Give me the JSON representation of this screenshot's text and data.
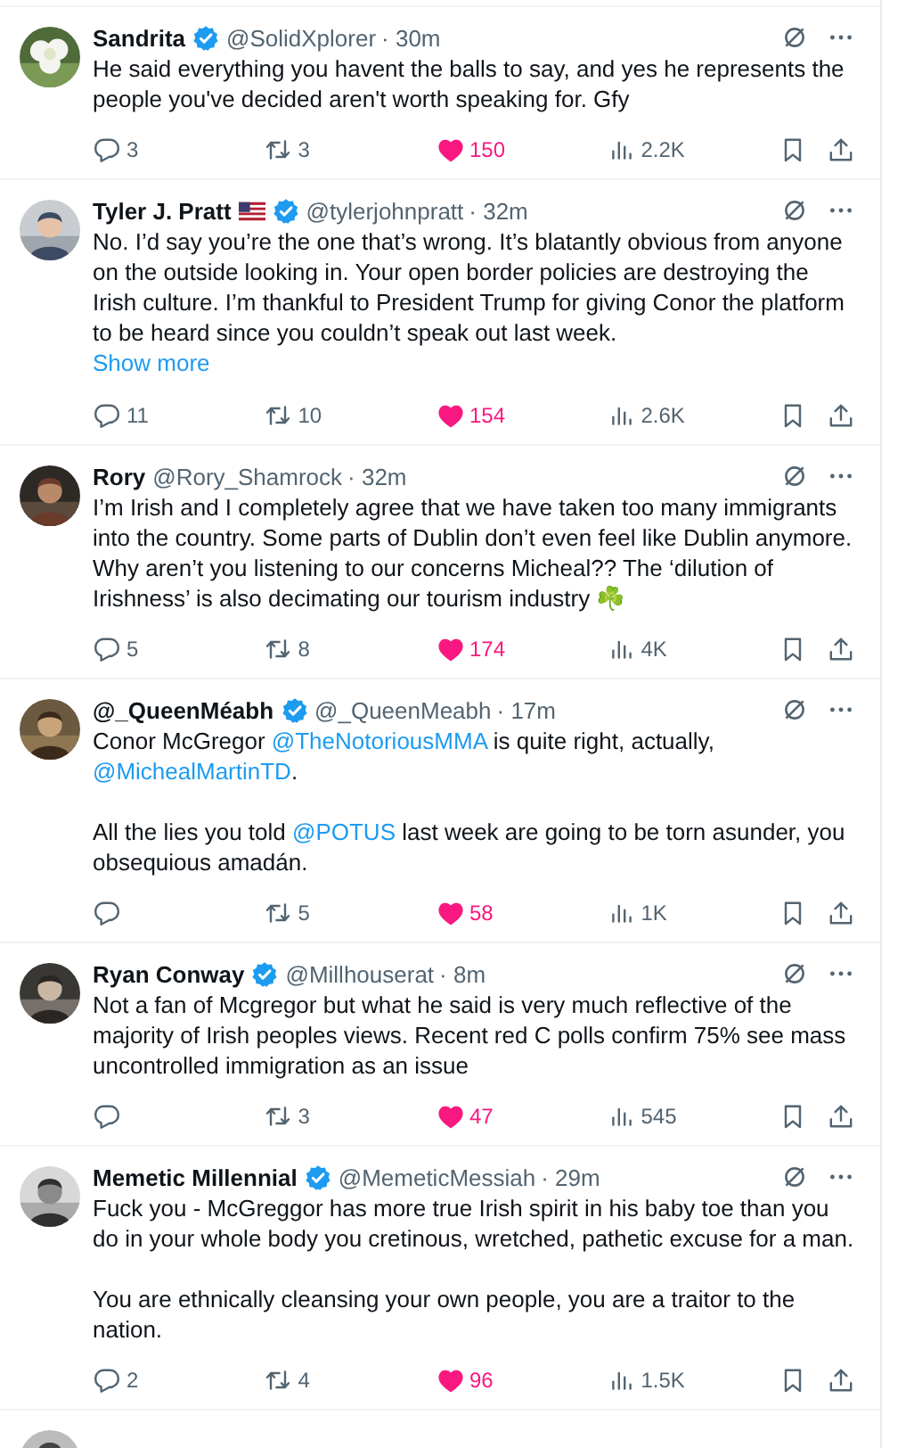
{
  "tweets": [
    {
      "kind": "post",
      "name": "Sandrita",
      "flag": false,
      "verified": true,
      "handle": "@SolidXplorer",
      "time": "· 30m",
      "paragraphs": [
        [
          {
            "text": "He said everything you havent the balls to say, and yes he represents the people you've decided aren't worth speaking for. Gfy",
            "kind": "text"
          }
        ]
      ],
      "replies": "3",
      "reposts": "3",
      "likes": "150",
      "views": "2.2K",
      "liked": true
    },
    {
      "kind": "post",
      "name": "Tyler J. Pratt",
      "flag": true,
      "verified": true,
      "handle": "@tylerjohnpratt",
      "time": "· 32m",
      "paragraphs": [
        [
          {
            "text": "No. I’d say you’re the one that’s wrong. It’s blatantly obvious from anyone on the outside looking in. Your open border policies are destroying the Irish culture. I’m thankful to President Trump for giving Conor the platform to be heard since you couldn’t speak out last week.",
            "kind": "text"
          }
        ]
      ],
      "show_more": "Show more",
      "replies": "11",
      "reposts": "10",
      "likes": "154",
      "views": "2.6K",
      "liked": true
    },
    {
      "kind": "post",
      "name": "Rory",
      "flag": false,
      "verified": false,
      "handle": "@Rory_Shamrock",
      "time": "· 32m",
      "paragraphs": [
        [
          {
            "text": "I’m Irish and I completely agree that we have taken too many immigrants into the country. Some parts of Dublin don’t even feel like Dublin anymore. Why aren’t you listening to our concerns Micheal?? The ‘dilution of Irishness’ is also decimating our tourism industry ☘️",
            "kind": "text"
          }
        ]
      ],
      "replies": "5",
      "reposts": "8",
      "likes": "174",
      "views": "4K",
      "liked": true
    },
    {
      "kind": "post",
      "name": "@_QueenMéabh",
      "flag": false,
      "verified": true,
      "handle": "@_QueenMeabh",
      "time": "· 17m",
      "paragraphs": [
        [
          {
            "text": "Conor McGregor ",
            "kind": "text"
          },
          {
            "text": "@TheNotoriousMMA",
            "kind": "mention"
          },
          {
            "text": " is quite right, actually, ",
            "kind": "text"
          },
          {
            "text": "@MichealMartinTD",
            "kind": "mention"
          },
          {
            "text": ".",
            "kind": "text"
          }
        ],
        [
          {
            "text": "All the lies you told ",
            "kind": "text"
          },
          {
            "text": "@POTUS",
            "kind": "mention"
          },
          {
            "text": " last week are going to be torn asunder, you obsequious amadán.",
            "kind": "text"
          }
        ]
      ],
      "reposts": "5",
      "likes": "58",
      "views": "1K",
      "liked": true
    },
    {
      "kind": "post",
      "name": "Ryan Conway",
      "flag": false,
      "verified": true,
      "handle": "@Millhouserat",
      "time": "· 8m",
      "paragraphs": [
        [
          {
            "text": "Not a fan of Mcgregor but what he said is very much reflective of the majority of Irish peoples views. Recent red C polls confirm 75% see mass uncontrolled immigration as an issue",
            "kind": "text"
          }
        ]
      ],
      "reposts": "3",
      "likes": "47",
      "views": "545",
      "liked": true
    },
    {
      "kind": "post",
      "name": "Memetic Millennial",
      "flag": false,
      "verified": true,
      "handle": "@MemeticMessiah",
      "time": "· 29m",
      "paragraphs": [
        [
          {
            "text": "Fuck you - McGreggor has more true Irish spirit in his baby toe than you do in your whole body you cretinous, wretched, pathetic excuse for a man.",
            "kind": "text"
          }
        ],
        [
          {
            "text": "You are ethnically cleansing your own people, you are a traitor to the nation.",
            "kind": "text"
          }
        ]
      ],
      "replies": "2",
      "reposts": "4",
      "likes": "96",
      "views": "1.5K",
      "liked": true
    },
    {
      "kind": "cut"
    }
  ]
}
